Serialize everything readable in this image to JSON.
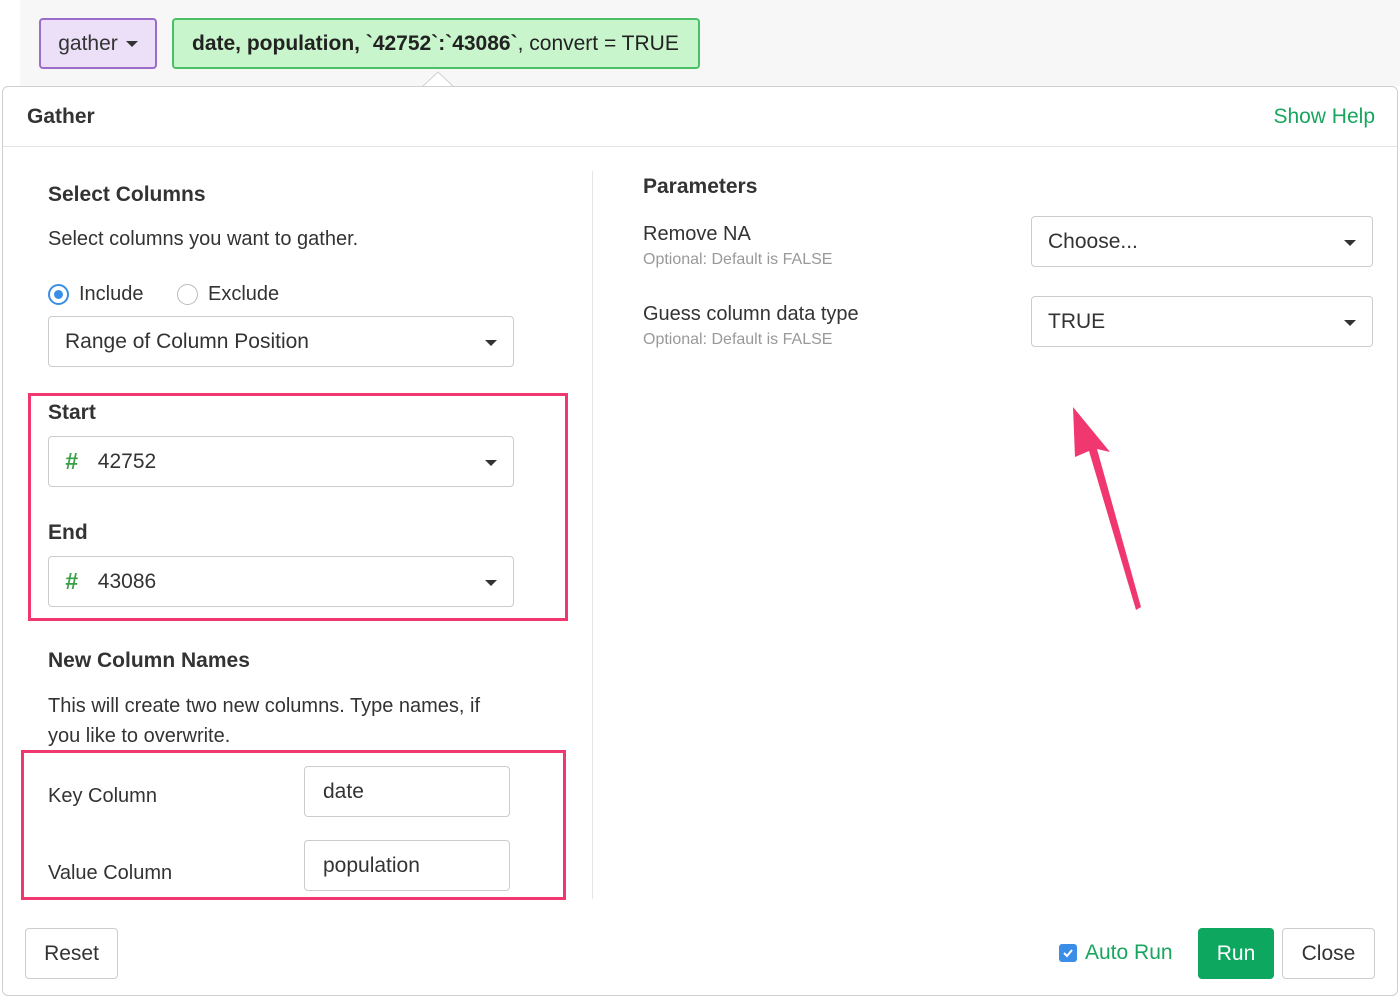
{
  "command": {
    "name": "gather",
    "expr_bold_1": "date, population, `42752`:`43086`",
    "expr_rest": ", convert = TRUE"
  },
  "dialog": {
    "title": "Gather",
    "show_help": "Show Help"
  },
  "select_columns": {
    "heading": "Select Columns",
    "description": "Select columns you want to gather.",
    "include_label": "Include",
    "exclude_label": "Exclude",
    "mode_value": "Range of Column Position",
    "start_label": "Start",
    "start_value": "42752",
    "end_label": "End",
    "end_value": "43086"
  },
  "new_columns": {
    "heading": "New Column Names",
    "description_line1": "This will create two new columns. Type names, if",
    "description_line2": "you like to overwrite.",
    "key_label": "Key Column",
    "key_value": "date",
    "value_label": "Value Column",
    "value_value": "population"
  },
  "parameters": {
    "heading": "Parameters",
    "remove_na_label": "Remove NA",
    "remove_na_hint": "Optional: Default is FALSE",
    "remove_na_value": "Choose...",
    "guess_label": "Guess column data type",
    "guess_hint": "Optional: Default is FALSE",
    "guess_value": "TRUE"
  },
  "footer": {
    "reset": "Reset",
    "auto_run": "Auto Run",
    "run": "Run",
    "close": "Close"
  },
  "colors": {
    "accent_green": "#0ea760",
    "highlight_pink": "#f0376f",
    "command_purple": "#ebe0f7",
    "expression_green": "#c8f5cc"
  },
  "icons": [
    "caret-down-icon",
    "number-hash-icon",
    "checkbox-checked-icon",
    "annotation-arrow-icon"
  ]
}
